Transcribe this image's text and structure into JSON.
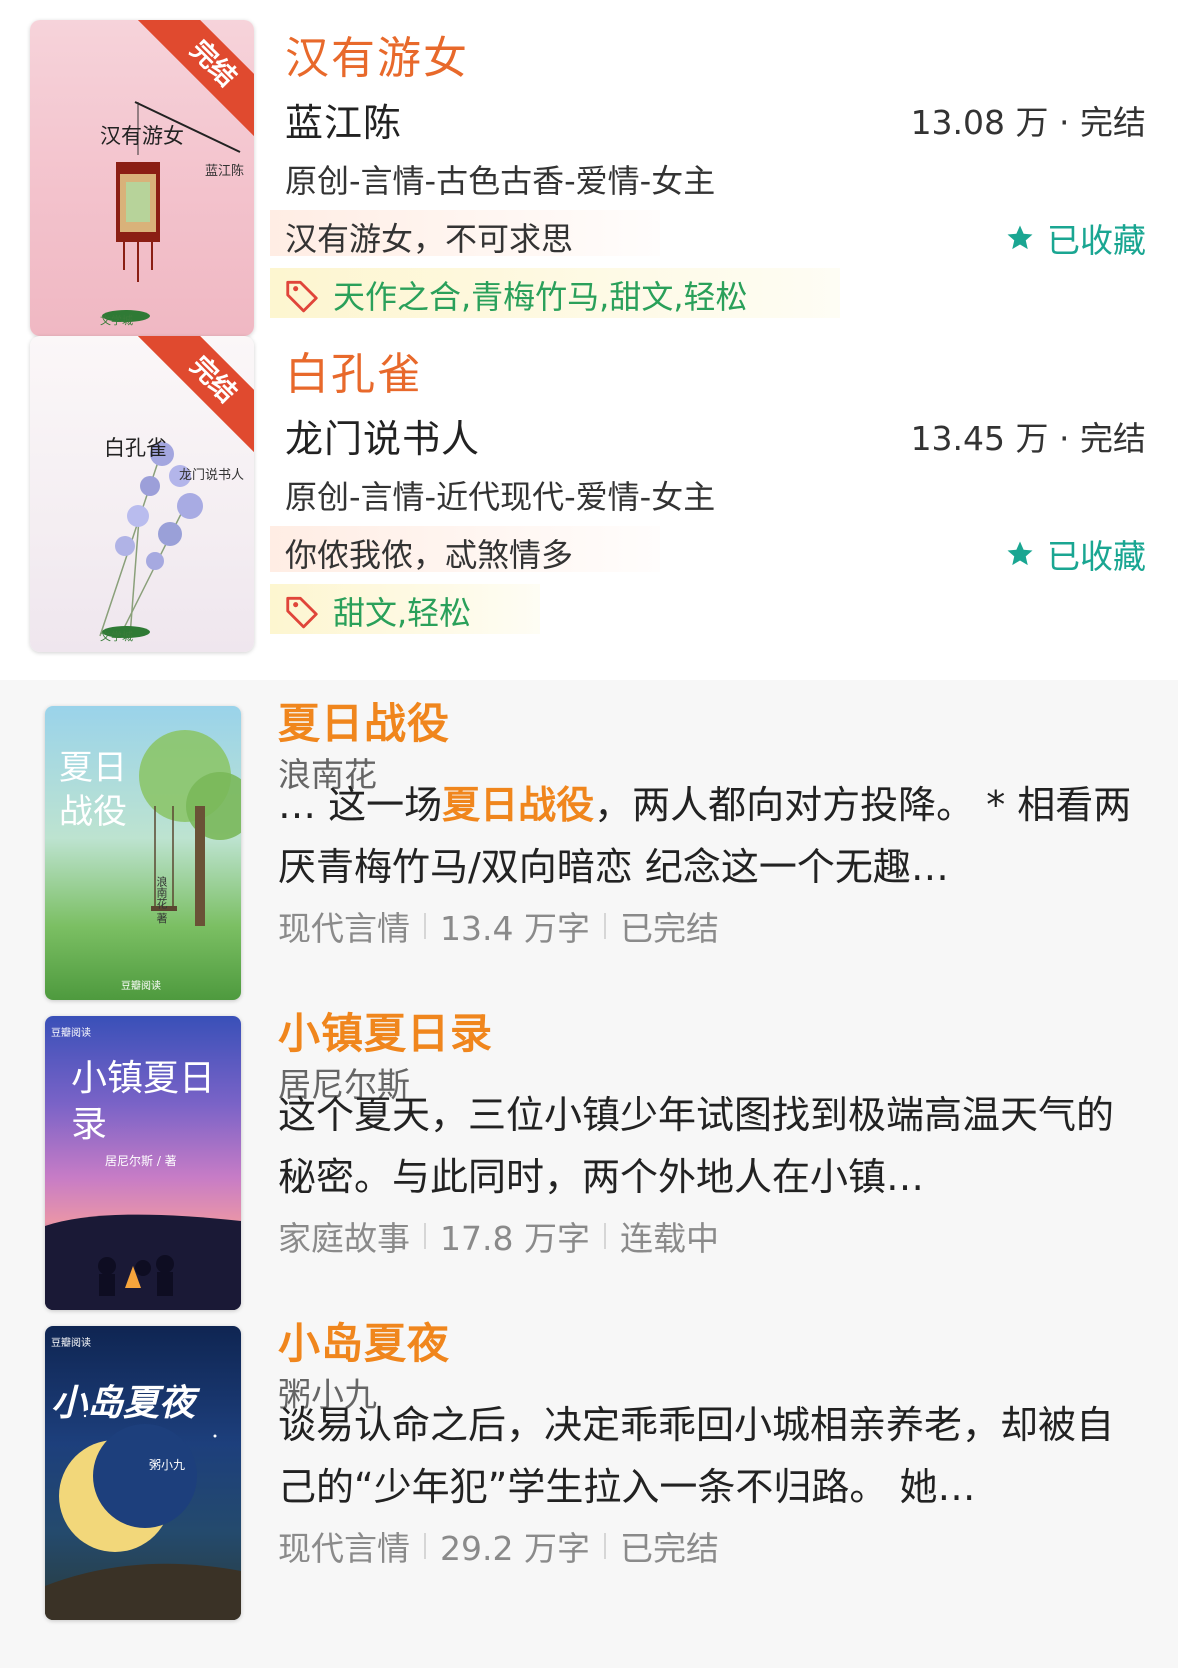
{
  "jj_books": [
    {
      "badge": "完结",
      "cover_title": "汉有游女",
      "cover_author": "蓝江陈",
      "cover_logo": "文学城",
      "title": "汉有游女",
      "author": "蓝江陈",
      "meta": "13.08 万 · 完结",
      "genre": "原创-言情-古色古香-爱情-女主",
      "intro": "汉有游女，不可求思",
      "fav_label": "已收藏",
      "tags": "天作之合,青梅竹马,甜文,轻松"
    },
    {
      "badge": "完结",
      "cover_title": "白孔雀",
      "cover_author": "龙门说书人",
      "cover_logo": "文学城",
      "title": "白孔雀",
      "author": "龙门说书人",
      "meta": "13.45 万 · 完结",
      "genre": "原创-言情-近代现代-爱情-女主",
      "intro": "你侬我侬，忒煞情多",
      "fav_label": "已收藏",
      "tags": "甜文,轻松"
    }
  ],
  "db_books": [
    {
      "cover_title": "夏日战役",
      "cover_author": "浪南花 著",
      "cover_logo": "豆瓣阅读",
      "title": "夏日战役",
      "author": "浪南花",
      "desc_pre": "… 这一场",
      "desc_hl": "夏日战役",
      "desc_post": "，两人都向对方投降。 * 相看两厌青梅竹马/双向暗恋 纪念这一个无趣…",
      "category": "现代言情",
      "words": "13.4 万字",
      "status": "已完结"
    },
    {
      "cover_title": "小镇夏日录",
      "cover_author": "居尼尔斯 / 著",
      "cover_logo": "豆瓣阅读",
      "title": "小镇夏日录",
      "author": "居尼尔斯",
      "desc_pre": "这个夏天，三位小镇少年试图找到极端高温天气的秘密。与此同时，两个外地人在小镇…",
      "desc_hl": "",
      "desc_post": "",
      "category": "家庭故事",
      "words": "17.8 万字",
      "status": "连载中"
    },
    {
      "cover_title": "小岛夏夜",
      "cover_author": "粥小九",
      "cover_logo": "豆瓣阅读",
      "title": "小岛夏夜",
      "author": "粥小九",
      "desc_pre": "谈易认命之后，决定乖乖回小城相亲养老，却被自己的“少年犯”学生拉入一条不归路。 她…",
      "desc_hl": "",
      "desc_post": "",
      "category": "现代言情",
      "words": "29.2 万字",
      "status": "已完结"
    }
  ],
  "colors": {
    "jj_title": "#e8692b",
    "jj_fav": "#1aa692",
    "jj_tag": "#2aa05a",
    "db_title": "#f0861d"
  }
}
